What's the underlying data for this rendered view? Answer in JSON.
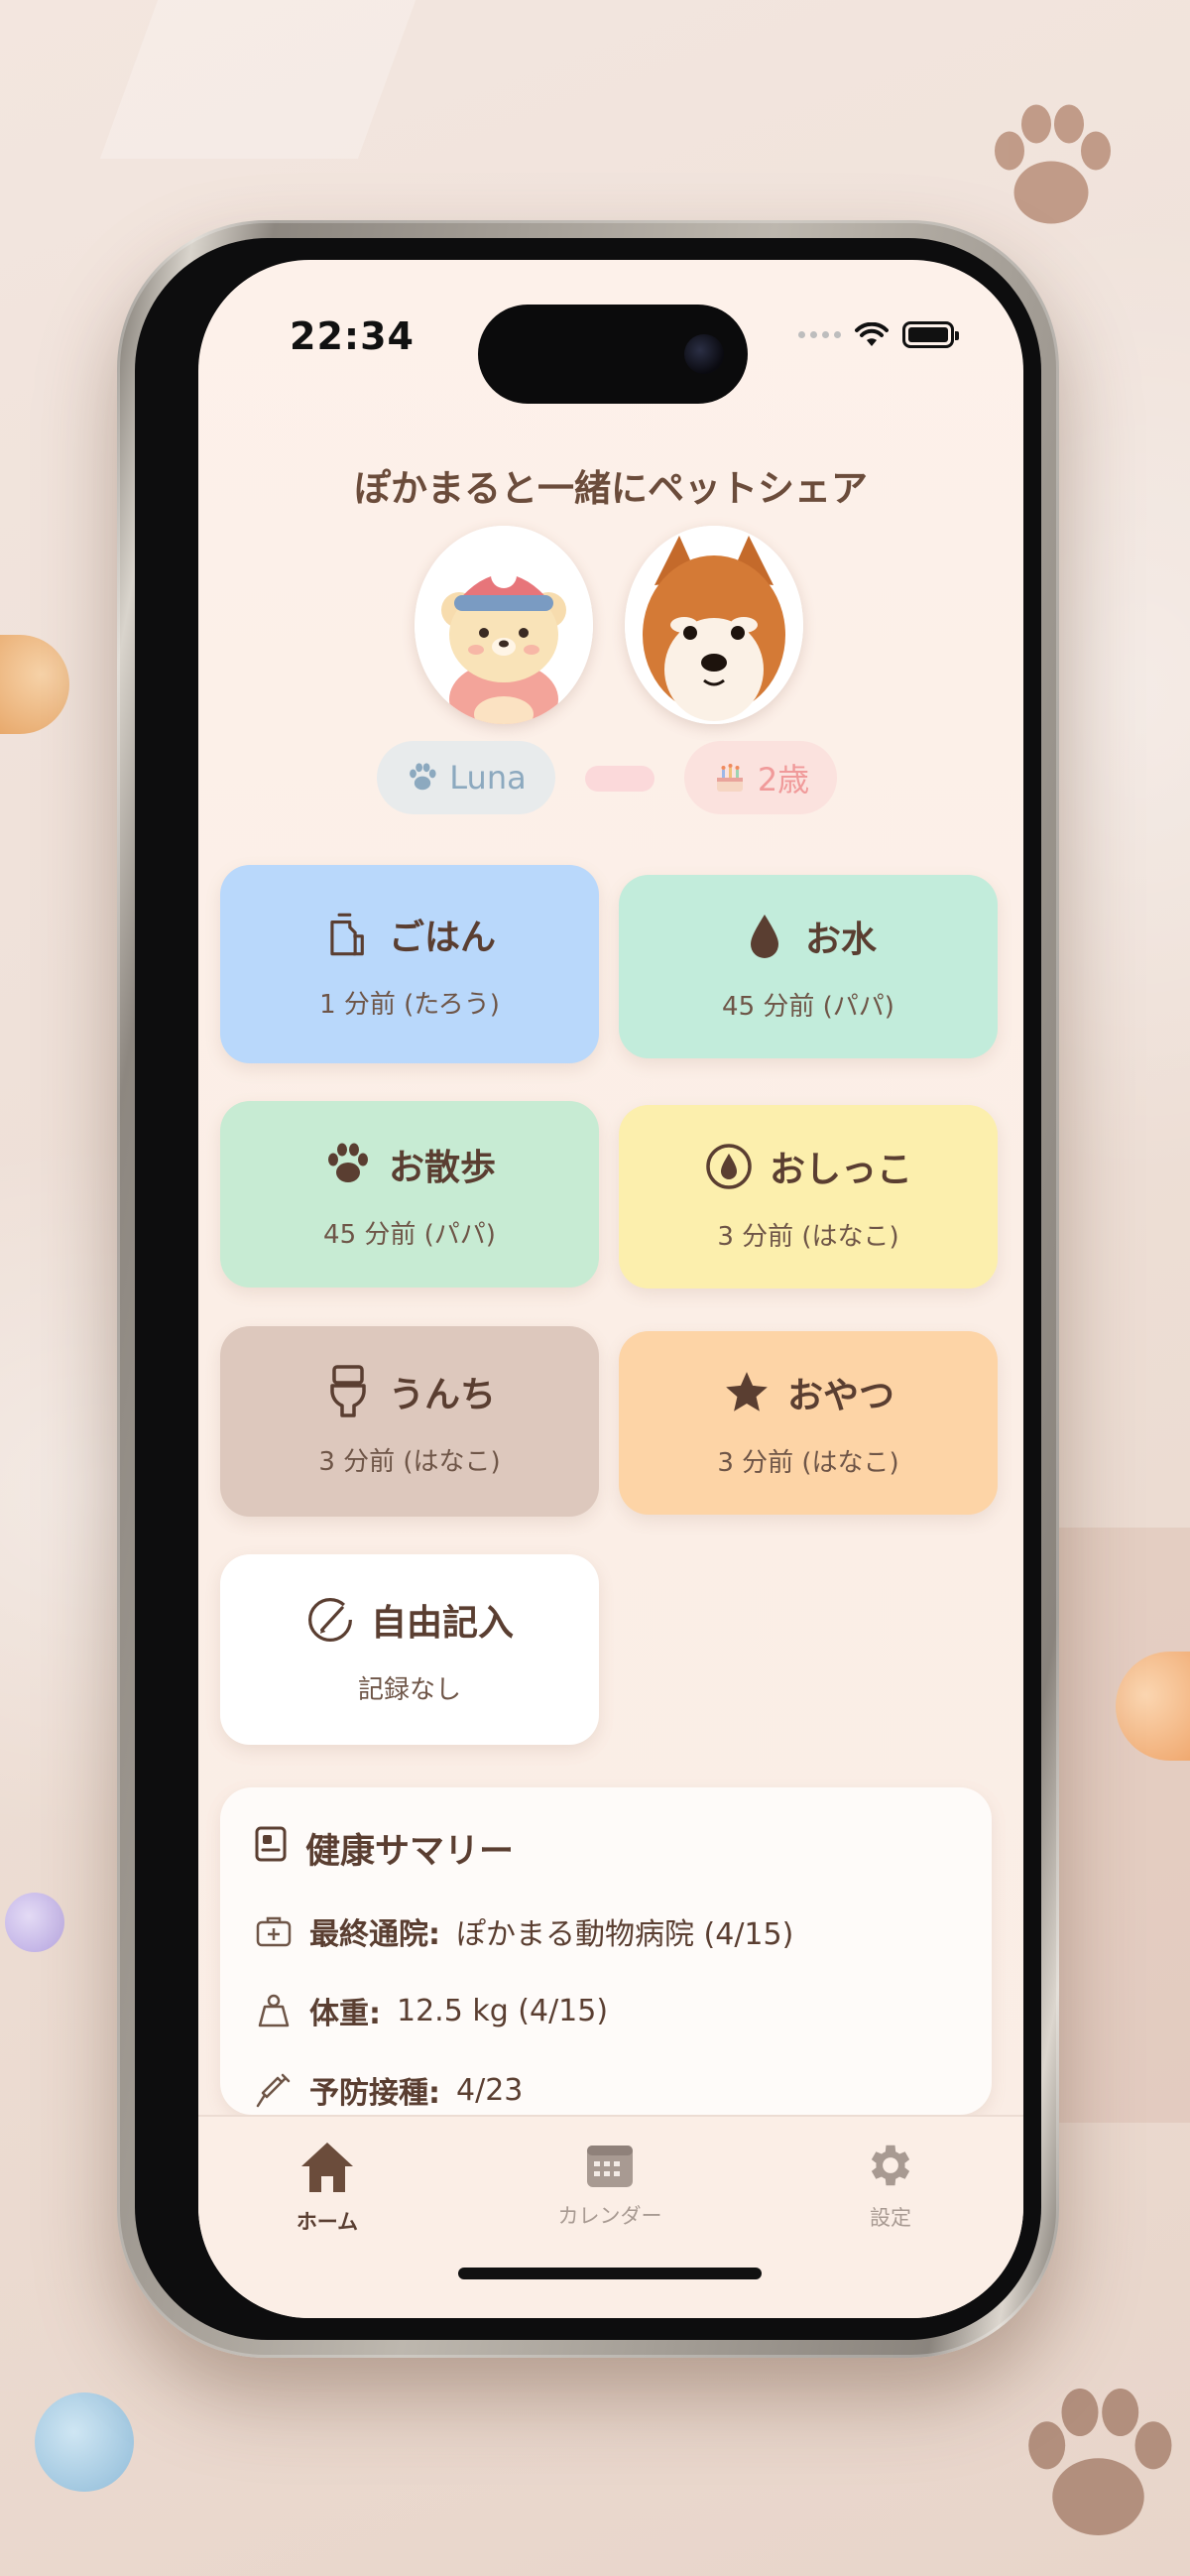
{
  "status_bar": {
    "time": "22:34"
  },
  "header": {
    "title": "ぽかまると一緒にペットシェア"
  },
  "pet": {
    "name": "Luna",
    "age": "2歳"
  },
  "actions": [
    {
      "label": "ごはん",
      "time": "1 分前 (たろう)",
      "icon": "food-bag-icon",
      "color": "#b9d8fb"
    },
    {
      "label": "お水",
      "time": "45 分前 (パパ)",
      "icon": "water-drop-icon",
      "color": "#c2ecdb"
    },
    {
      "label": "お散歩",
      "time": "45 分前 (パパ)",
      "icon": "paw-icon",
      "color": "#c7ebd3"
    },
    {
      "label": "おしっこ",
      "time": "3 分前 (はなこ)",
      "icon": "pee-drop-icon",
      "color": "#fcefad"
    },
    {
      "label": "うんち",
      "time": "3 分前 (はなこ)",
      "icon": "toilet-icon",
      "color": "#ddc8bd"
    },
    {
      "label": "おやつ",
      "time": "3 分前 (はなこ)",
      "icon": "star-icon",
      "color": "#fdd4a6"
    },
    {
      "label": "自由記入",
      "time": "記録なし",
      "icon": "edit-icon",
      "color": "#ffffff"
    }
  ],
  "health": {
    "title": "健康サマリー",
    "rows": [
      {
        "label": "最終通院:",
        "value": "ぽかまる動物病院 (4/15)",
        "icon": "medical-kit-icon"
      },
      {
        "label": "体重:",
        "value": "12.5 kg (4/15)",
        "icon": "weight-icon"
      },
      {
        "label": "予防接種:",
        "value": "4/23",
        "icon": "syringe-icon"
      }
    ]
  },
  "tabs": [
    {
      "label": "ホーム",
      "icon": "home-icon",
      "active": true
    },
    {
      "label": "カレンダー",
      "icon": "calendar-icon",
      "active": false
    },
    {
      "label": "設定",
      "icon": "gear-icon",
      "active": false
    }
  ]
}
